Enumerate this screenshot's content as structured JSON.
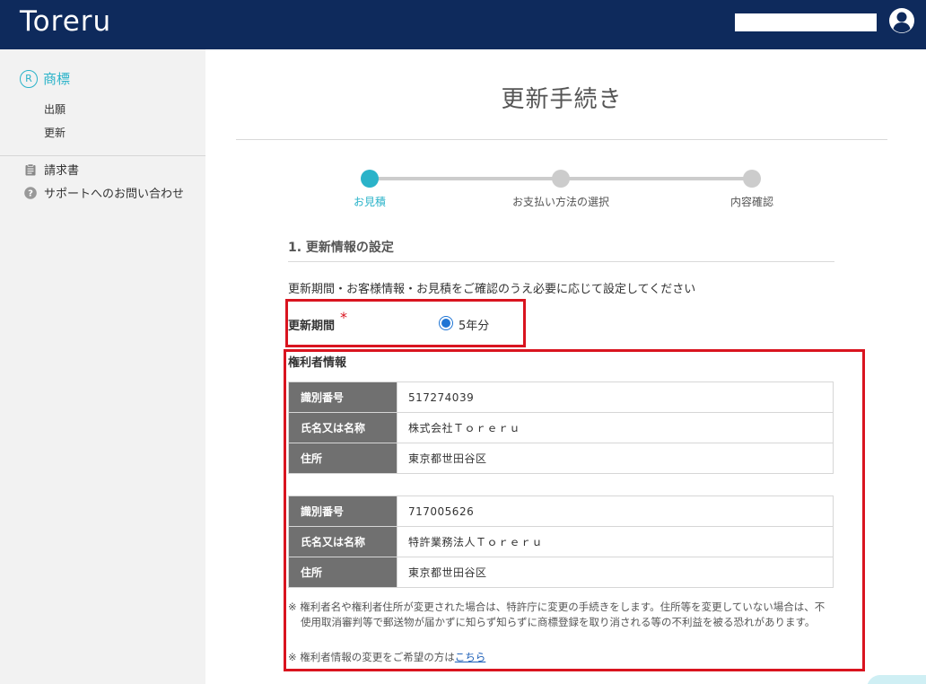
{
  "header": {
    "logo": "Toreru"
  },
  "sidebar": {
    "main_item": {
      "icon": "registered-trademark-icon",
      "label": "商標"
    },
    "sub_items": [
      "出願",
      "更新"
    ],
    "links": [
      {
        "icon": "clipboard-icon",
        "label": "請求書"
      },
      {
        "icon": "help-icon",
        "label": "サポートへのお問い合わせ"
      }
    ]
  },
  "main": {
    "title": "更新手続き",
    "steps": [
      {
        "label": "お見積",
        "active": true
      },
      {
        "label": "お支払い方法の選択",
        "active": false
      },
      {
        "label": "内容確認",
        "active": false
      }
    ],
    "section_title": "1. 更新情報の設定",
    "description": "更新期間・お客様情報・お見積をご確認のうえ必要に応じて設定してください",
    "period": {
      "label": "更新期間",
      "required_mark": "*",
      "option": "5年分",
      "selected": true
    },
    "holder": {
      "title": "権利者情報",
      "records": [
        [
          {
            "key": "識別番号",
            "value": "517274039"
          },
          {
            "key": "氏名又は名称",
            "value": "株式会社Ｔｏｒｅｒｕ"
          },
          {
            "key": "住所",
            "value": "東京都世田谷区"
          }
        ],
        [
          {
            "key": "識別番号",
            "value": "717005626"
          },
          {
            "key": "氏名又は名称",
            "value": "特許業務法人Ｔｏｒｅｒｕ"
          },
          {
            "key": "住所",
            "value": "東京都世田谷区"
          }
        ]
      ],
      "note1": "※ 権利者名や権利者住所が変更された場合は、特許庁に変更の手続きをします。住所等を変更していない場合は、不使用取消審判等で郵送物が届かずに知らず知らずに商標登録を取り消される等の不利益を被る恐れがあります。",
      "note2_prefix": "※ 権利者情報の変更をご希望の方は",
      "note2_link": "こちら"
    }
  },
  "colors": {
    "header_bg": "#0e2a5c",
    "accent": "#2ab3c9",
    "step_inactive": "#cccccc",
    "highlight_border": "#d9141f",
    "table_header_bg": "#707070"
  }
}
